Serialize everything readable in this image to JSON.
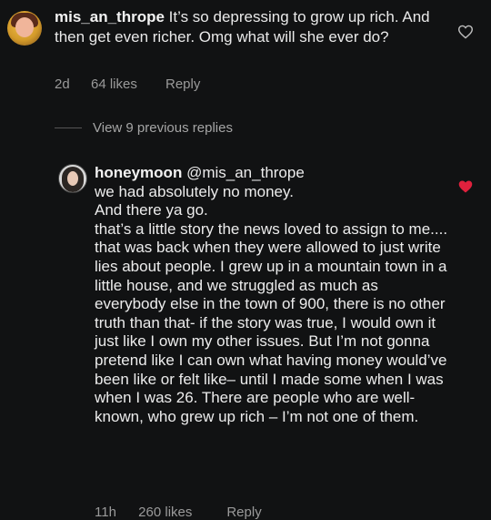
{
  "comments": [
    {
      "username": "mis_an_thrope",
      "text": "It’s so depressing to grow up rich. And then get even richer. Omg what will she ever do?",
      "time": "2d",
      "likes": "64 likes",
      "reply_label": "Reply",
      "liked": false
    },
    {
      "username": "honeymoon",
      "mention": "@mis_an_thrope",
      "paragraphs": [
        "we had absolutely no money.",
        "And there ya go.",
        "that’s a little story the news loved to assign to me.... that was back when they were allowed to just write lies about people. I grew up in a mountain town in a little house, and we struggled as much as everybody else in the town of 900, there is no other truth than that- if the story was true, I would own it just like I own my other issues. But I’m not gonna pretend like I can own what having money would’ve been like or felt like– until I made some when I was when I was 26. There are people who are well-known, who grew up rich – I’m not one of them."
      ],
      "time": "11h",
      "likes": "260 likes",
      "reply_label": "Reply",
      "liked": true
    }
  ],
  "view_replies_label": "View 9 previous replies",
  "colors": {
    "background": "#111213",
    "text": "#e9e9e9",
    "meta": "#9a9a9a",
    "heart_red": "#e0213d"
  },
  "icons": {
    "like_outline": "heart-outline-icon",
    "like_filled": "heart-filled-icon"
  }
}
